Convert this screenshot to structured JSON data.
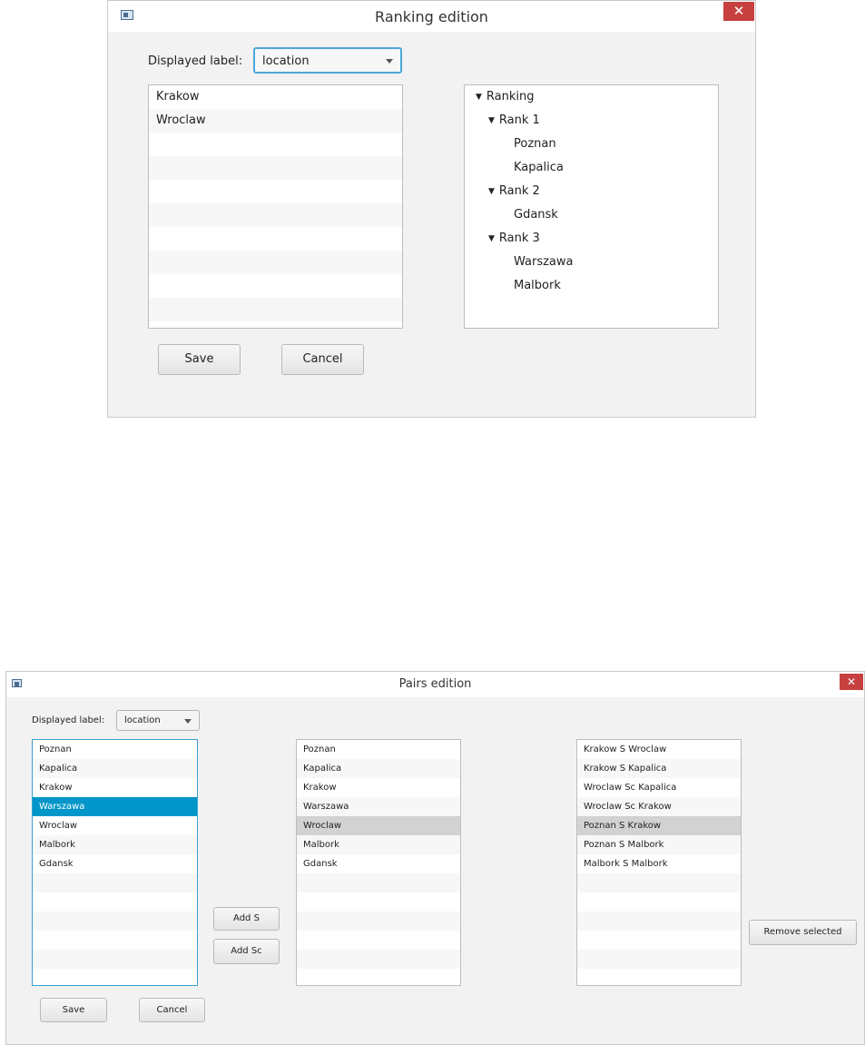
{
  "ranking_window": {
    "title": "Ranking edition",
    "close_glyph": "✕",
    "displayed_label": {
      "label": "Displayed label:",
      "value": "location"
    },
    "list_items": [
      "Krakow",
      "Wroclaw"
    ],
    "tree": {
      "root": "Ranking",
      "ranks": [
        {
          "label": "Rank 1",
          "items": [
            "Poznan",
            "Kapalica"
          ]
        },
        {
          "label": "Rank 2",
          "items": [
            "Gdansk"
          ]
        },
        {
          "label": "Rank 3",
          "items": [
            "Warszawa",
            "Malbork"
          ]
        }
      ]
    },
    "buttons": {
      "save": "Save",
      "cancel": "Cancel"
    },
    "expand_glyph": "▼"
  },
  "pairs_window": {
    "title": "Pairs edition",
    "close_glyph": "✕",
    "displayed_label": {
      "label": "Displayed label:",
      "value": "location"
    },
    "left_list": [
      "Poznan",
      "Kapalica",
      "Krakow",
      "Warszawa",
      "Wroclaw",
      "Malbork",
      "Gdansk"
    ],
    "left_selected": "Warszawa",
    "middle_list": [
      "Poznan",
      "Kapalica",
      "Krakow",
      "Warszawa",
      "Wroclaw",
      "Malbork",
      "Gdansk"
    ],
    "middle_selected": "Wroclaw",
    "pairs_list": [
      "Krakow S Wroclaw",
      "Krakow S Kapalica",
      "Wroclaw Sc Kapalica",
      "Wroclaw Sc Krakow",
      "Poznan S Krakow",
      "Poznan S Malbork",
      "Malbork S Malbork"
    ],
    "pairs_selected": "Poznan S Krakow",
    "buttons": {
      "add_s": "Add S",
      "add_sc": "Add Sc",
      "remove_selected": "Remove selected",
      "save": "Save",
      "cancel": "Cancel"
    }
  }
}
